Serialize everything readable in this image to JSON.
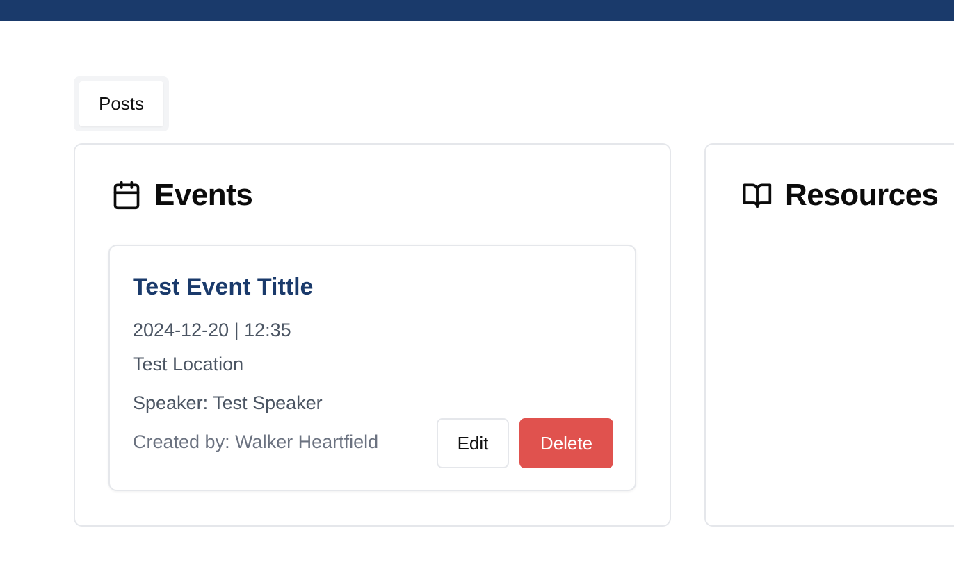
{
  "colors": {
    "brand": "#1a3a6b",
    "danger": "#e0524e",
    "border": "#e5e7eb"
  },
  "tabs": [
    {
      "label": "Posts",
      "icon": ""
    }
  ],
  "events_panel": {
    "title": "Events",
    "icon": "calendar-icon",
    "items": [
      {
        "title": "Test Event Tittle",
        "datetime": "2024-12-20 | 12:35",
        "location": "Test Location",
        "speaker": "Speaker: Test Speaker",
        "created_by": "Created by: Walker Heartfield",
        "edit_label": "Edit",
        "delete_label": "Delete"
      }
    ]
  },
  "resources_panel": {
    "title": "Resources",
    "icon": "book-open-icon"
  }
}
